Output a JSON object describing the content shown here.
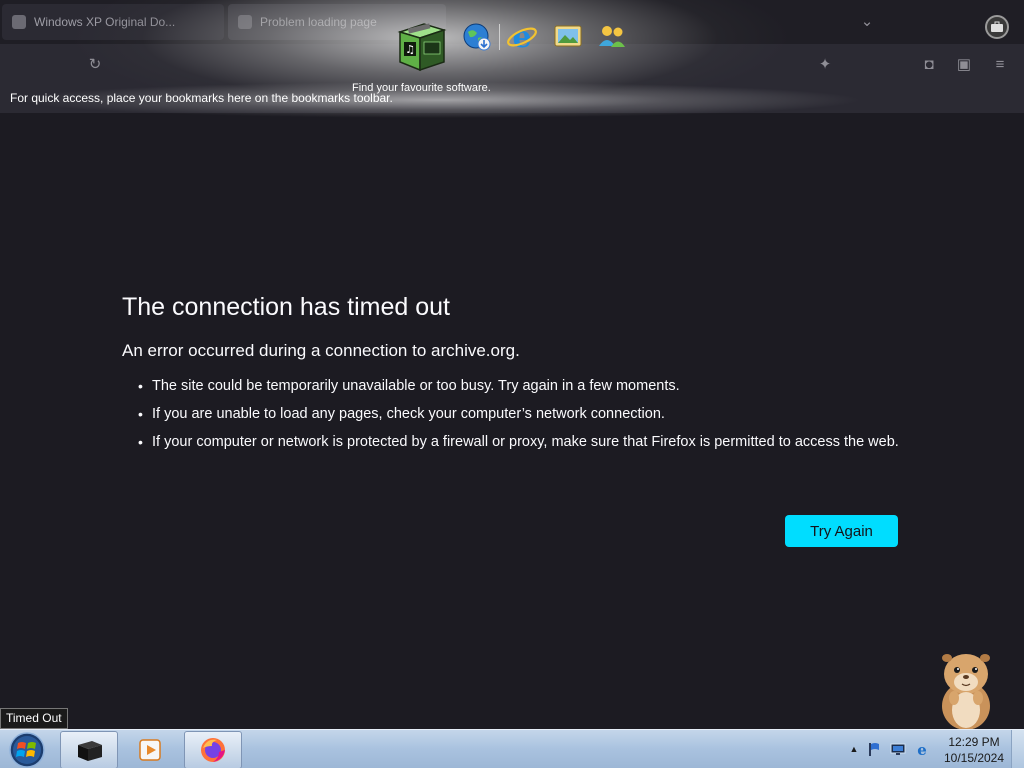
{
  "browser": {
    "tabs": [
      {
        "label": "Windows XP Original Do..."
      },
      {
        "label": "Problem loading page"
      }
    ],
    "bookmarks_hint": "For quick access, place your bookmarks here on the bookmarks toolbar."
  },
  "dock": {
    "caption": "Find your favourite software.",
    "icons": [
      "software-box-icon",
      "globe-download-icon",
      "internet-explorer-icon",
      "photo-viewer-icon",
      "people-icon"
    ]
  },
  "error_page": {
    "title": "The connection has timed out",
    "subtitle": "An error occurred during a connection to archive.org.",
    "bullets": [
      "The site could be temporarily unavailable or too busy. Try again in a few moments.",
      "If you are unable to load any pages, check your computer’s network connection.",
      "If your computer or network is protected by a firewall or proxy, make sure that Firefox is permitted to access the web."
    ],
    "try_again_label": "Try Again"
  },
  "tooltip": "Timed Out",
  "taskbar": {
    "clock_time": "12:29 PM",
    "clock_date": "10/15/2024",
    "tray_chevron": "▲"
  },
  "colors": {
    "page_background": "#1c1b22",
    "button_accent": "#00ddff",
    "taskbar": "#a9c2df"
  }
}
